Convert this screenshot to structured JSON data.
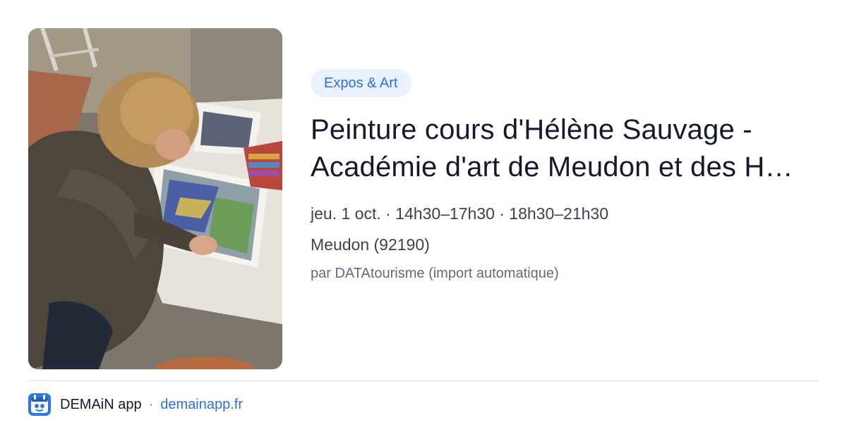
{
  "event": {
    "category": "Expos & Art",
    "title": "Peinture cours d'Hélène Sauvage - Académie d'art de Meudon et des H…",
    "dates": "jeu. 1 oct. · 14h30–17h30 · 18h30–21h30",
    "location": "Meudon (92190)",
    "source": "par DATAtourisme (import automatique)"
  },
  "footer": {
    "app_name": "DEMAiN app",
    "separator": "·",
    "domain": "demainapp.fr",
    "app_icon": "app-logo-icon"
  },
  "colors": {
    "accent": "#2f6fd6",
    "pill_background": "#e8f1fd",
    "title": "#141a2e",
    "muted": "#5f6b80"
  }
}
